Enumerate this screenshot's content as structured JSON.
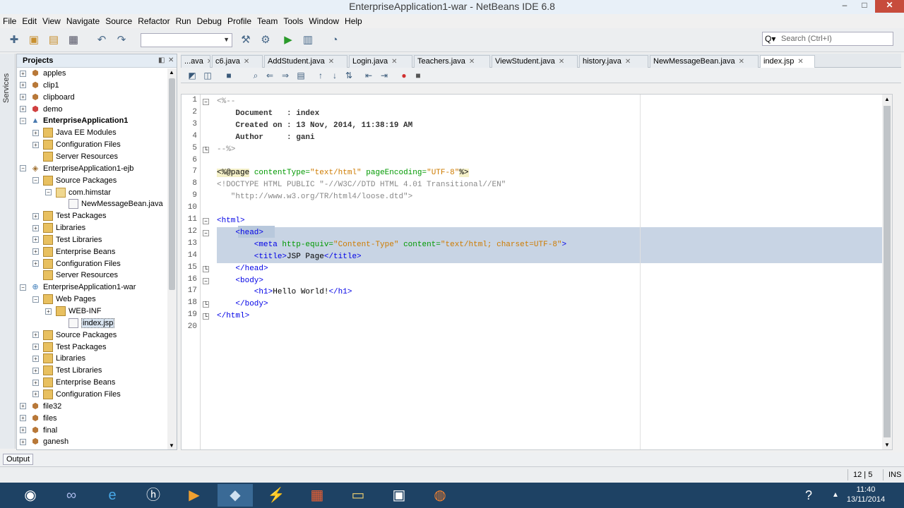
{
  "window": {
    "title": "EnterpriseApplication1-war - NetBeans IDE 6.8",
    "minimize": "–",
    "maximize": "□",
    "close": "✕"
  },
  "menu": [
    "File",
    "Edit",
    "View",
    "Navigate",
    "Source",
    "Refactor",
    "Run",
    "Debug",
    "Profile",
    "Team",
    "Tools",
    "Window",
    "Help"
  ],
  "search": {
    "placeholder": "Search (Ctrl+I)",
    "icon": "Q▾"
  },
  "services_label": "Services",
  "projects": {
    "title": "Projects",
    "tree": [
      {
        "label": "apples",
        "icon": "proj",
        "expander": "+"
      },
      {
        "label": "clip1",
        "icon": "proj",
        "expander": "+"
      },
      {
        "label": "clipboard",
        "icon": "proj",
        "expander": "+"
      },
      {
        "label": "demo",
        "icon": "proj-red",
        "expander": "+"
      },
      {
        "label": "EnterpriseApplication1",
        "icon": "ear",
        "expander": "−",
        "bold": true
      },
      {
        "label": "Java EE Modules",
        "icon": "folder",
        "expander": "+"
      },
      {
        "label": "Configuration Files",
        "icon": "folder",
        "expander": "+"
      },
      {
        "label": "Server Resources",
        "icon": "folder",
        "expander": ""
      },
      {
        "label": "EnterpriseApplication1-ejb",
        "icon": "ejb",
        "expander": "−"
      },
      {
        "label": "Source Packages",
        "icon": "folder",
        "expander": "−"
      },
      {
        "label": "com.himstar",
        "icon": "pkg",
        "expander": "−"
      },
      {
        "label": "NewMessageBean.java",
        "icon": "file",
        "expander": ""
      },
      {
        "label": "Test Packages",
        "icon": "folder",
        "expander": "+"
      },
      {
        "label": "Libraries",
        "icon": "folder",
        "expander": "+"
      },
      {
        "label": "Test Libraries",
        "icon": "folder",
        "expander": "+"
      },
      {
        "label": "Enterprise Beans",
        "icon": "folder",
        "expander": "+"
      },
      {
        "label": "Configuration Files",
        "icon": "folder",
        "expander": "+"
      },
      {
        "label": "Server Resources",
        "icon": "folder",
        "expander": ""
      },
      {
        "label": "EnterpriseApplication1-war",
        "icon": "war",
        "expander": "−"
      },
      {
        "label": "Web Pages",
        "icon": "folder",
        "expander": "−"
      },
      {
        "label": "WEB-INF",
        "icon": "folder",
        "expander": "+"
      },
      {
        "label": "index.jsp",
        "icon": "file",
        "expander": "",
        "selected": true
      },
      {
        "label": "Source Packages",
        "icon": "folder",
        "expander": "+"
      },
      {
        "label": "Test Packages",
        "icon": "folder",
        "expander": "+"
      },
      {
        "label": "Libraries",
        "icon": "folder",
        "expander": "+"
      },
      {
        "label": "Test Libraries",
        "icon": "folder",
        "expander": "+"
      },
      {
        "label": "Enterprise Beans",
        "icon": "folder",
        "expander": "+"
      },
      {
        "label": "Configuration Files",
        "icon": "folder",
        "expander": "+"
      },
      {
        "label": "file32",
        "icon": "proj",
        "expander": "+"
      },
      {
        "label": "files",
        "icon": "proj",
        "expander": "+"
      },
      {
        "label": "final",
        "icon": "proj",
        "expander": "+"
      },
      {
        "label": "ganesh",
        "icon": "proj",
        "expander": "+"
      }
    ]
  },
  "tabs": [
    {
      "label": "...ava"
    },
    {
      "label": "c6.java"
    },
    {
      "label": "AddStudent.java"
    },
    {
      "label": "Login.java"
    },
    {
      "label": "Teachers.java"
    },
    {
      "label": "ViewStudent.java"
    },
    {
      "label": "history.java"
    },
    {
      "label": "NewMessageBean.java"
    },
    {
      "label": "index.jsp",
      "active": true
    }
  ],
  "editor": {
    "lines": [
      {
        "n": "1",
        "parts": [
          [
            "c-comment",
            "<%--"
          ]
        ],
        "fold": "−"
      },
      {
        "n": "2",
        "parts": [
          [
            "c-bold",
            "    Document   : index"
          ]
        ]
      },
      {
        "n": "3",
        "parts": [
          [
            "c-bold",
            "    Created on : 13 Nov, 2014, 11:38:19 AM"
          ]
        ]
      },
      {
        "n": "4",
        "parts": [
          [
            "c-bold",
            "    Author     : gani"
          ]
        ]
      },
      {
        "n": "5",
        "parts": [
          [
            "c-comment",
            "--%>"
          ]
        ],
        "fold": "└"
      },
      {
        "n": "6",
        "parts": []
      },
      {
        "n": "7",
        "parts": [
          [
            "c-jsp",
            "<%@page"
          ],
          [
            "c-attr",
            " contentType="
          ],
          [
            "c-val",
            "\"text/html\""
          ],
          [
            "c-attr",
            " pageEncoding="
          ],
          [
            "c-val",
            "\"UTF-8\""
          ],
          [
            "c-jsp",
            "%>"
          ]
        ]
      },
      {
        "n": "8",
        "parts": [
          [
            "c-doc",
            "<!DOCTYPE HTML PUBLIC \"-//W3C//DTD HTML 4.01 Transitional//EN\""
          ]
        ]
      },
      {
        "n": "9",
        "parts": [
          [
            "c-doc",
            "   \"http://www.w3.org/TR/html4/loose.dtd\">"
          ]
        ]
      },
      {
        "n": "10",
        "parts": []
      },
      {
        "n": "11",
        "parts": [
          [
            "c-tag",
            "<html>"
          ]
        ],
        "fold": "−"
      },
      {
        "n": "12",
        "parts": [
          [
            "c-tag",
            "    <head>"
          ]
        ],
        "fold": "−"
      },
      {
        "n": "13",
        "parts": [
          [
            "c-tag",
            "        <meta "
          ],
          [
            "c-attr",
            "http-equiv="
          ],
          [
            "c-val",
            "\"Content-Type\""
          ],
          [
            "c-attr",
            " content="
          ],
          [
            "c-val",
            "\"text/html; charset=UTF-8\""
          ],
          [
            "c-tag",
            ">"
          ]
        ]
      },
      {
        "n": "14",
        "parts": [
          [
            "c-tag",
            "        <title>"
          ],
          [
            "c-text",
            "JSP Page"
          ],
          [
            "c-tag",
            "</title>"
          ]
        ]
      },
      {
        "n": "15",
        "parts": [
          [
            "c-tag",
            "    </head>"
          ]
        ],
        "fold": "└"
      },
      {
        "n": "16",
        "parts": [
          [
            "c-tag",
            "    <body>"
          ]
        ],
        "fold": "−"
      },
      {
        "n": "17",
        "parts": [
          [
            "c-tag",
            "        <h1>"
          ],
          [
            "c-text",
            "Hello World!"
          ],
          [
            "c-tag",
            "</h1>"
          ]
        ]
      },
      {
        "n": "18",
        "parts": [
          [
            "c-tag",
            "    </body>"
          ]
        ],
        "fold": "└"
      },
      {
        "n": "19",
        "parts": [
          [
            "c-tag",
            "</html>"
          ]
        ],
        "fold": "└"
      },
      {
        "n": "20",
        "parts": []
      }
    ]
  },
  "output_tab": "Output",
  "status": {
    "position": "12 | 5",
    "mode": "INS"
  },
  "taskbar": {
    "time": "11:40",
    "date": "13/11/2014",
    "help": "?",
    "tray_arrow": "▲"
  },
  "colors": {
    "taskbar": "#1e4264",
    "selection": "#c8d4e4",
    "close": "#c74c3c"
  }
}
